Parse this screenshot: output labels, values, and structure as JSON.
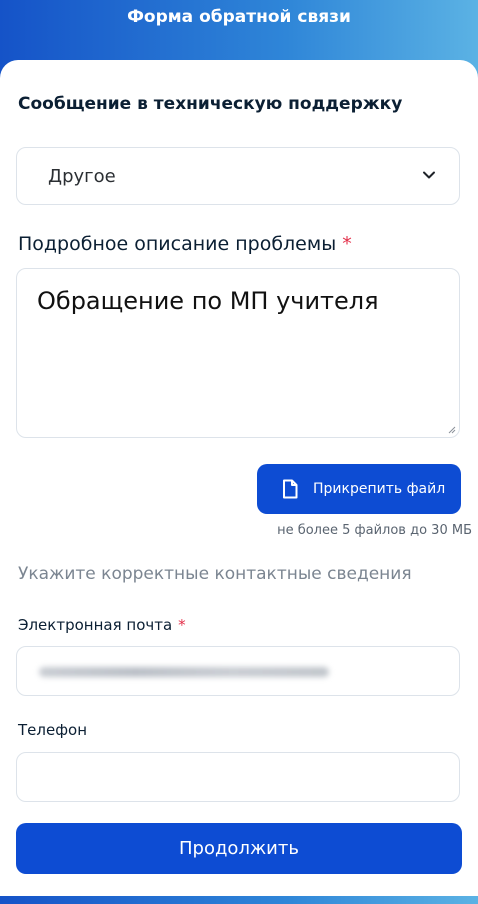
{
  "header": {
    "title": "Форма обратной связи"
  },
  "form": {
    "section_title": "Сообщение в техническую поддержку",
    "topic": {
      "selected": "Другое"
    },
    "description": {
      "label": "Подробное описание проблемы",
      "required_mark": "*",
      "value": "Обращение по МП учителя"
    },
    "attach": {
      "label": "Прикрепить файл",
      "note": "не более 5 файлов до 30 МБ"
    },
    "contacts": {
      "title": "Укажите корректные контактные сведения",
      "email": {
        "label": "Электронная почта",
        "required_mark": "*"
      },
      "phone": {
        "label": "Телефон",
        "value": ""
      }
    },
    "submit_label": "Продолжить"
  },
  "icons": {
    "chevron": "chevron-down-icon",
    "attach": "file-icon"
  },
  "colors": {
    "primary": "#0d4cd3",
    "required": "#e3304a",
    "header_gradient_start": "#1553c8",
    "header_gradient_end": "#5bb2e4"
  }
}
